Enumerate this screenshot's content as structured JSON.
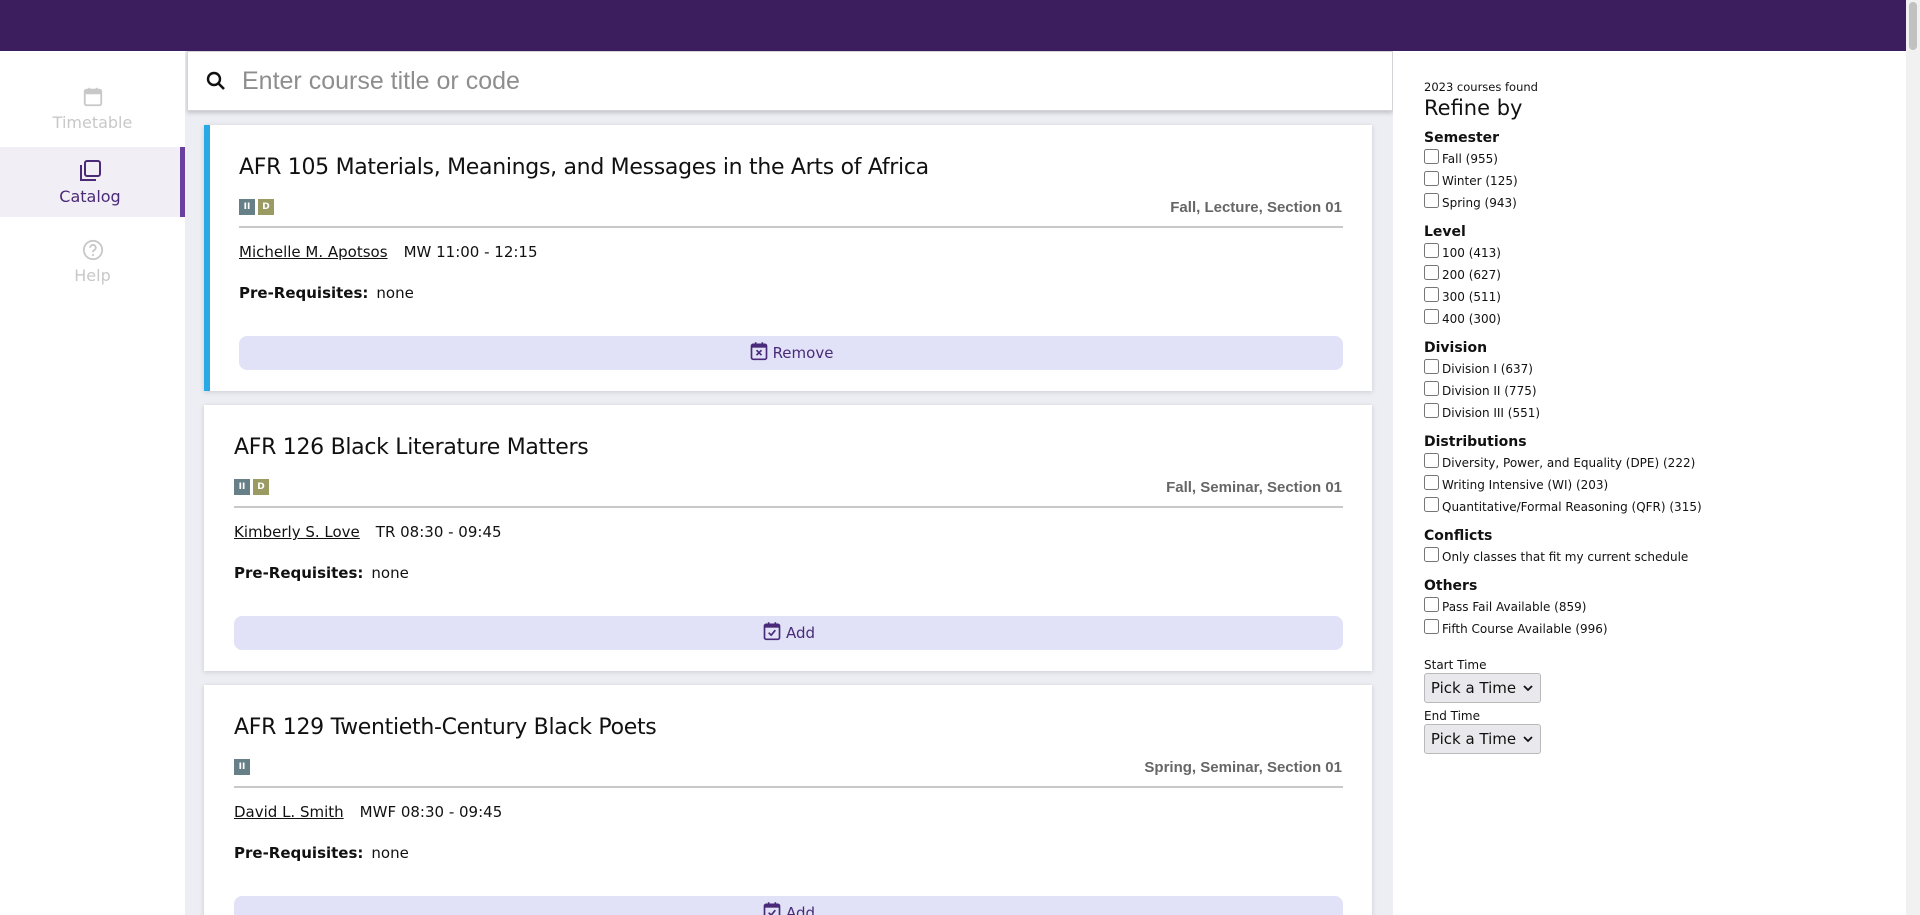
{
  "sidebar": {
    "items": [
      {
        "label": "Timetable",
        "icon": "calendar-icon",
        "active": false
      },
      {
        "label": "Catalog",
        "icon": "catalog-icon",
        "active": true
      },
      {
        "label": "Help",
        "icon": "help-icon",
        "active": false
      }
    ]
  },
  "search": {
    "placeholder": "Enter course title or code",
    "value": ""
  },
  "courses": [
    {
      "title": "AFR 105 Materials, Meanings, and Messages in the Arts of Africa",
      "badges": [
        "II",
        "D"
      ],
      "section": "Fall, Lecture, Section 01",
      "instructor": "Michelle M. Apotsos",
      "schedule": "MW 11:00 - 12:15",
      "prereq_label": "Pre-Requisites:",
      "prereq_value": "none",
      "action": "Remove",
      "selected": true
    },
    {
      "title": "AFR 126 Black Literature Matters",
      "badges": [
        "II",
        "D"
      ],
      "section": "Fall, Seminar, Section 01",
      "instructor": "Kimberly S. Love",
      "schedule": "TR 08:30 - 09:45",
      "prereq_label": "Pre-Requisites:",
      "prereq_value": "none",
      "action": "Add",
      "selected": false
    },
    {
      "title": "AFR 129 Twentieth-Century Black Poets",
      "badges": [
        "II"
      ],
      "section": "Spring, Seminar, Section 01",
      "instructor": "David L. Smith",
      "schedule": "MWF 08:30 - 09:45",
      "prereq_label": "Pre-Requisites:",
      "prereq_value": "none",
      "action": "Add",
      "selected": false
    }
  ],
  "filters": {
    "found": "2023 courses found",
    "refine_title": "Refine by",
    "semester": {
      "title": "Semester",
      "options": [
        "Fall (955)",
        "Winter (125)",
        "Spring (943)"
      ]
    },
    "level": {
      "title": "Level",
      "options": [
        "100 (413)",
        "200 (627)",
        "300 (511)",
        "400 (300)"
      ]
    },
    "division": {
      "title": "Division",
      "options": [
        "Division I (637)",
        "Division II (775)",
        "Division III (551)"
      ]
    },
    "distributions": {
      "title": "Distributions",
      "options": [
        "Diversity, Power, and Equality (DPE) (222)",
        "Writing Intensive (WI) (203)",
        "Quantitative/Formal Reasoning (QFR) (315)"
      ]
    },
    "conflicts": {
      "title": "Conflicts",
      "options": [
        "Only classes that fit my current schedule"
      ]
    },
    "others": {
      "title": "Others",
      "options": [
        "Pass Fail Available (859)",
        "Fifth Course Available (996)"
      ]
    },
    "start_time_label": "Start Time",
    "end_time_label": "End Time",
    "pick_time": "Pick a Time"
  },
  "colors": {
    "topbar": "#3c1e5f",
    "accent": "#4a2a78",
    "selected_border": "#29a8e6",
    "button_bg": "#e1e2f7"
  }
}
